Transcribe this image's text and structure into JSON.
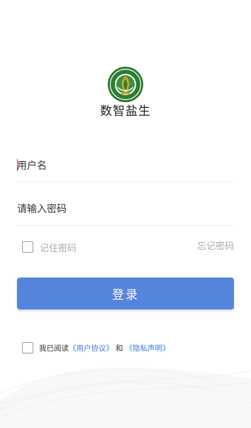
{
  "app": {
    "name": "数智盐生"
  },
  "login_form": {
    "username_placeholder": "用户名",
    "password_placeholder": "请输入密码",
    "remember_label": "记住密码",
    "forgot_label": "忘记密码",
    "submit_label": "登录"
  },
  "agreement": {
    "prefix": "我已阅读",
    "user_agreement": "《用户协议》",
    "conjunction": "和",
    "privacy_policy": "《隐私声明》"
  },
  "colors": {
    "primary": "#5584dd",
    "link": "#3f7fd8",
    "logo_green": "#2e7d32",
    "logo_gold": "#d4a72c",
    "caret": "#d6336c"
  },
  "icons": {
    "logo": "school-emblem-icon"
  }
}
